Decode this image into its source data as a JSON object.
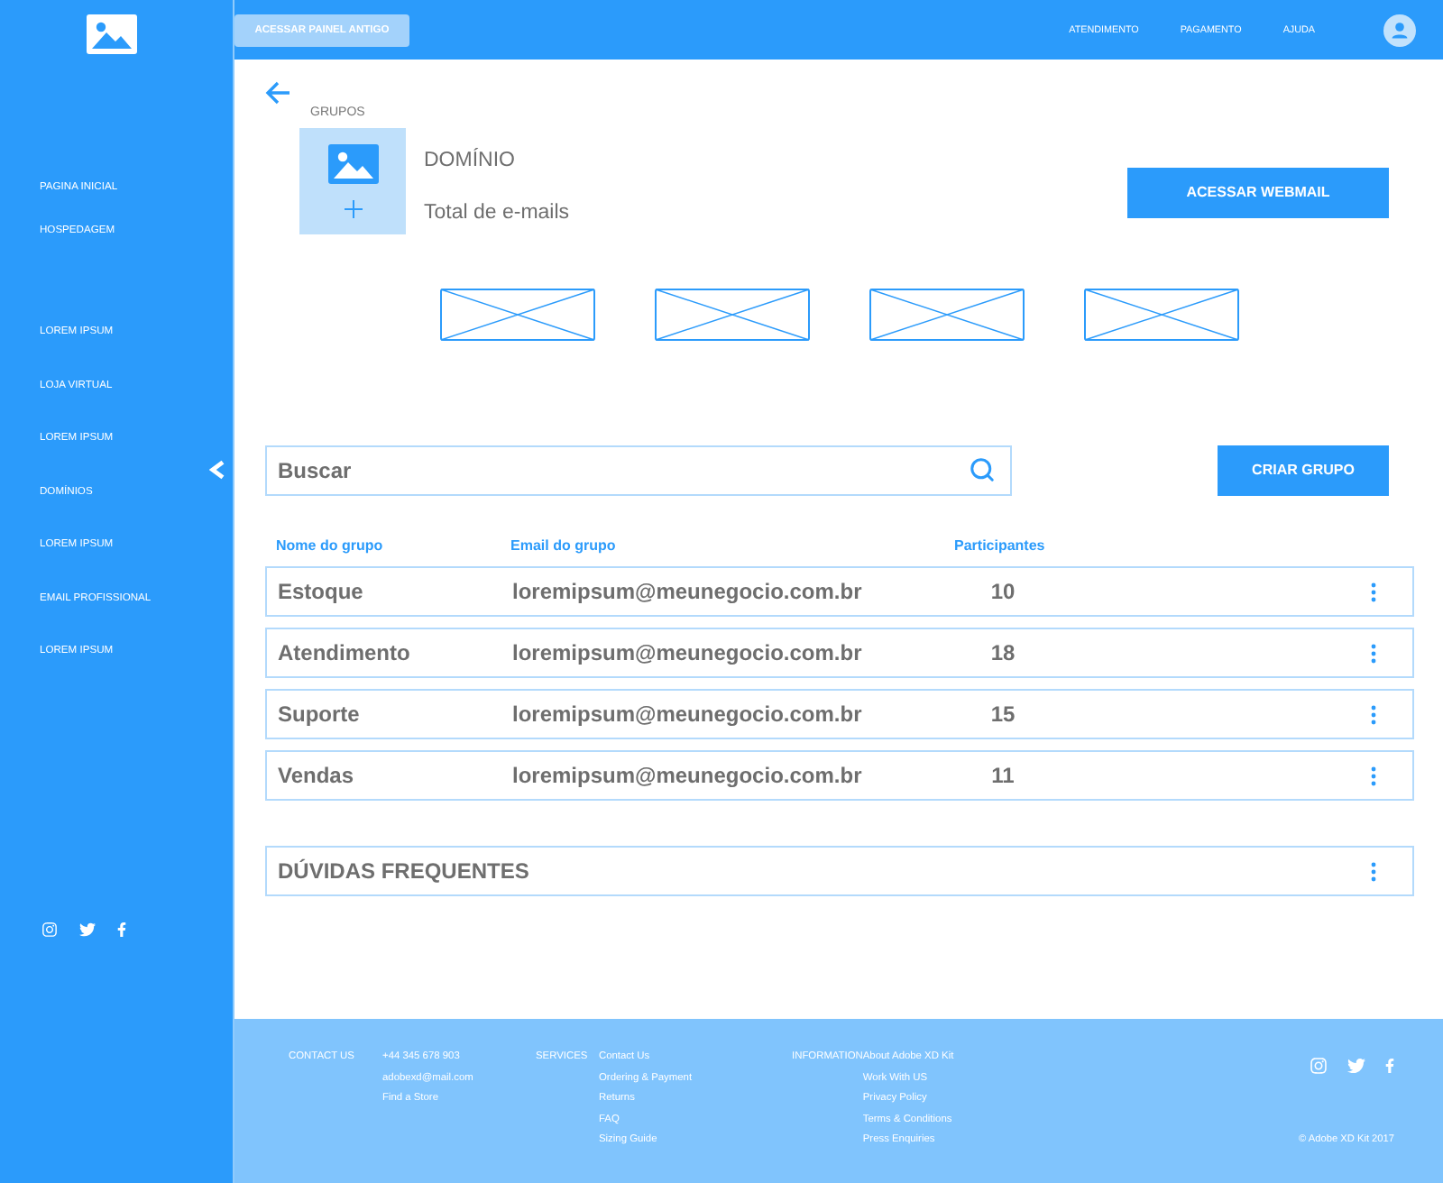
{
  "sidebar": {
    "menu_groups": [
      {
        "items": [
          {
            "label": "PAGINA INICIAL"
          },
          {
            "label": "HOSPEDAGEM"
          }
        ]
      },
      {
        "items": [
          {
            "label": "LOREM IPSUM"
          },
          {
            "label": "LOJA VIRTUAL"
          },
          {
            "label": "LOREM IPSUM"
          },
          {
            "label": "DOMÍNIOS"
          },
          {
            "label": "LOREM IPSUM"
          },
          {
            "label": "EMAIL PROFISSIONAL"
          },
          {
            "label": "LOREM IPSUM"
          }
        ]
      }
    ]
  },
  "top_bar": {
    "legacy_button": "ACESSAR PAINEL ANTIGO",
    "nav_links": [
      "ATENDIMENTO",
      "PAGAMENTO",
      "AJUDA"
    ]
  },
  "header": {
    "breadcrumb": "GRUPOS",
    "title": "DOMÍNIO",
    "subtitle": "Total de e-mails",
    "webmail_button": "ACESSAR WEBMAIL"
  },
  "search": {
    "placeholder": "Buscar"
  },
  "create_group_button": "CRIAR GRUPO",
  "table": {
    "columns": [
      "Nome do grupo",
      "Email do grupo",
      "Participantes"
    ],
    "rows": [
      {
        "name": "Estoque",
        "email": "loremipsum@meunegocio.com.br",
        "participants": "10"
      },
      {
        "name": "Atendimento",
        "email": "loremipsum@meunegocio.com.br",
        "participants": "18"
      },
      {
        "name": "Suporte",
        "email": "loremipsum@meunegocio.com.br",
        "participants": "15"
      },
      {
        "name": "Vendas",
        "email": "loremipsum@meunegocio.com.br",
        "participants": "11"
      }
    ]
  },
  "faq": {
    "title": "DÚVIDAS FREQUENTES"
  },
  "footer": {
    "columns": [
      {
        "heading": "CONTACT US",
        "links": [
          "+44 345 678 903",
          "adobexd@mail.com",
          "Find a Store"
        ]
      },
      {
        "heading": "SERVICES",
        "links": [
          "Contact Us",
          "Ordering & Payment",
          "Returns",
          "FAQ",
          "Sizing Guide"
        ]
      },
      {
        "heading": "INFORMATION",
        "links": [
          "About Adobe XD Kit",
          "Work With US",
          "Privacy Policy",
          "Terms & Conditions",
          "Press Enquiries"
        ]
      }
    ],
    "copyright": "© Adobe XD Kit 2017"
  }
}
